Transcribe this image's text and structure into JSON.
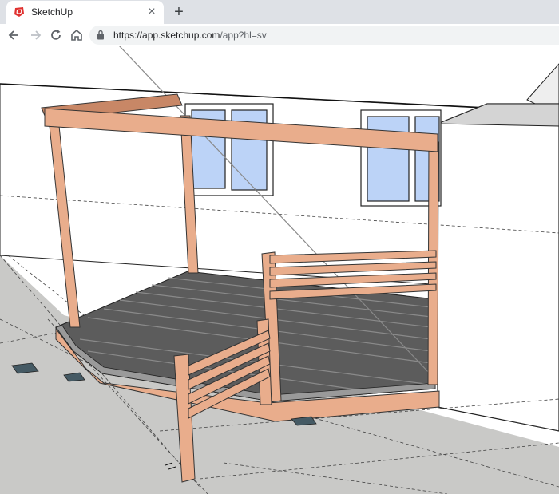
{
  "browser": {
    "tab_title": "SketchUp",
    "tab_icon": "sketchup-logo-icon",
    "url_host": "https://app.sketchup.com",
    "url_path": "/app?hl=sv",
    "new_tab_label": "+",
    "close_label": "×"
  },
  "colors": {
    "tabstrip": "#dee1e6",
    "omnibox": "#f1f3f4",
    "wood": "#e9ad8c",
    "wood_dark": "#c88766",
    "decking": "#5f5f5f",
    "ground": "#c8c8c8",
    "wall": "#ffffff",
    "glass": "#bcd3f7"
  }
}
